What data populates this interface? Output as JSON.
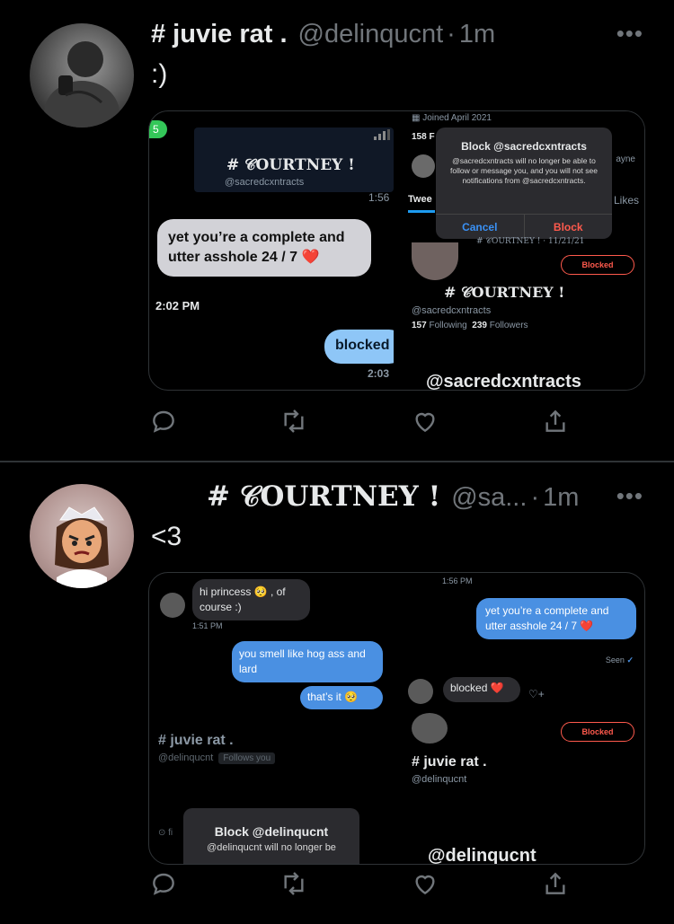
{
  "tweets": [
    {
      "name": "# juvie rat .",
      "handle": "@delinqucnt",
      "dot": "·",
      "time": "1m",
      "more": "•••",
      "text": ":)",
      "media": {
        "badge": "5",
        "chat_name": "# 𝒞OURTNEY !",
        "chat_handle": "@sacredcxntracts",
        "time_top": "1:56",
        "bubble_gray": "yet you’re a complete and utter  asshole 24 / 7 ❤️",
        "time_mid": "2:02 PM",
        "bubble_blue": "blocked",
        "time_bottom": "2:03",
        "joined": "Joined April 2021",
        "count_158": "158 F",
        "tweets_label": "Twee",
        "likes_label": "Likes",
        "ayne": "ayne",
        "dialog_title": "Block @sacredcxntracts",
        "dialog_body": "@sacredcxntracts will no longer be able to follow or message you, and you will not see notifications from @sacredcxntracts.",
        "dialog_cancel": "Cancel",
        "dialog_block": "Block",
        "courtney_line": "# 𝒞OURTNEY ! · 11/21/21",
        "blocked_pill": "Blocked",
        "profile_name": "# 𝒞OURTNEY !",
        "profile_handle": "@sacredcxntracts",
        "following_count": "157",
        "following_label": "Following",
        "followers_count": "239",
        "followers_label": "Followers",
        "watermark": "@sacredcxntracts"
      }
    },
    {
      "name": "# 𝒞OURTNEY !",
      "handle": "@sa...",
      "dot": "·",
      "time": "1m",
      "more": "•••",
      "text": "<3",
      "media": {
        "hi_bubble": "hi princess 🥺 , of course :)",
        "time_151": "1:51 PM",
        "smell_bubble": "you smell like hog ass and lard",
        "thats_bubble": "that’s it 🥺",
        "left_name": "# juvie rat .",
        "left_handle": "@delinqucnt",
        "follows_you": "Follows you",
        "pin": "⊙ fi",
        "block_title": "Block @delinqucnt",
        "block_body": "@delinqucnt will no longer be",
        "time_156": "1:56 PM",
        "yet_bubble": "yet you’re a complete and utter  asshole 24 / 7 ❤️",
        "seen": "Seen",
        "seen_check": "✓",
        "blocked_gray": "blocked ❤️",
        "blocked_pill": "Blocked",
        "right_name": "# juvie rat .",
        "right_handle": "@delinqucnt",
        "watermark": "@delinqucnt"
      }
    }
  ],
  "colors": {
    "background": "#000000",
    "text": "#e7e9ea",
    "muted": "#71767b",
    "accent_blue": "#1d9bf0",
    "danger": "#ff5a4d"
  }
}
